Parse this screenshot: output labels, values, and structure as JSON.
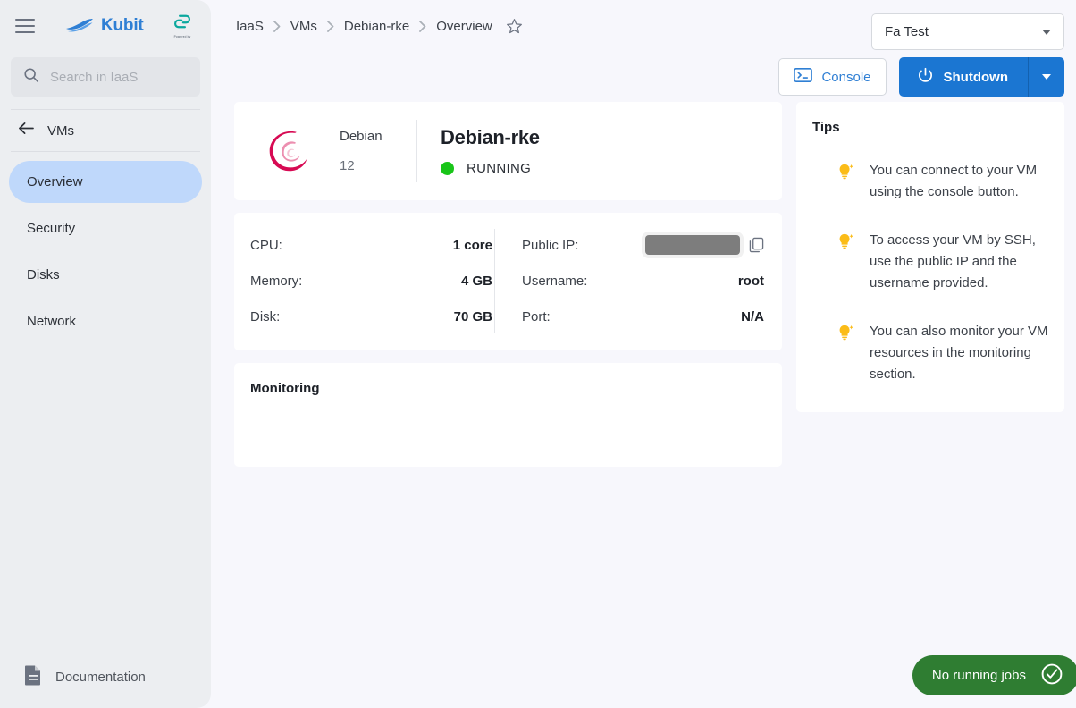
{
  "sidebar": {
    "menu_icon": "hamburger-icon",
    "brand": {
      "name": "Kubit",
      "logo_icon": "kubit-boat-logo"
    },
    "partner_logo": {
      "icon": "partner-s-logo",
      "caption": "Powered by"
    },
    "search": {
      "placeholder": "Search in IaaS",
      "value": "",
      "icon": "search-icon"
    },
    "back": {
      "label": "VMs",
      "icon": "arrow-left-icon"
    },
    "items": [
      {
        "label": "Overview",
        "active": true
      },
      {
        "label": "Security",
        "active": false
      },
      {
        "label": "Disks",
        "active": false
      },
      {
        "label": "Network",
        "active": false
      }
    ],
    "documentation": {
      "label": "Documentation",
      "icon": "document-icon"
    }
  },
  "header": {
    "breadcrumb": [
      "IaaS",
      "VMs",
      "Debian-rke",
      "Overview"
    ],
    "favorite_icon": "star-outline-icon",
    "tenant_select": {
      "value": "Fa Test",
      "caret_icon": "chevron-down-icon"
    }
  },
  "actions": {
    "console": {
      "label": "Console",
      "icon": "terminal-icon"
    },
    "shutdown": {
      "label": "Shutdown",
      "icon": "power-icon"
    },
    "shutdown_more": {
      "icon": "chevron-down-icon"
    }
  },
  "vm": {
    "distro_name": "Debian",
    "distro_version": "12",
    "distro_icon": "debian-swirl-logo",
    "name": "Debian-rke",
    "status": "RUNNING",
    "status_color": "#19c519"
  },
  "specs": {
    "left": [
      {
        "key": "CPU:",
        "value": "1 core"
      },
      {
        "key": "Memory:",
        "value": "4 GB"
      },
      {
        "key": "Disk:",
        "value": "70 GB"
      }
    ],
    "right": [
      {
        "key": "Public IP:",
        "value": "",
        "redacted": true,
        "copy_icon": "copy-icon"
      },
      {
        "key": "Username:",
        "value": "root"
      },
      {
        "key": "Port:",
        "value": "N/A"
      }
    ]
  },
  "monitoring": {
    "title": "Monitoring"
  },
  "tips": {
    "title": "Tips",
    "icon": "lightbulb-icon",
    "items": [
      "You can connect to your VM using the console button.",
      "To access your VM by SSH, use the public IP and the username provided.",
      "You can also monitor your VM resources in the monitoring section."
    ]
  },
  "status_bar": {
    "jobs": {
      "label": "No running jobs",
      "icon": "check-circle-icon",
      "color": "#2f7d32"
    }
  },
  "colors": {
    "accent_blue": "#1b76d2",
    "brand_blue": "#2f7fd4",
    "active_nav": "#bfd8fb",
    "sidebar_bg": "#eceef1",
    "page_bg": "#f7f7fc",
    "success_green": "#2f7d32",
    "status_green": "#19c519",
    "debian_crimson": "#d70a53"
  }
}
